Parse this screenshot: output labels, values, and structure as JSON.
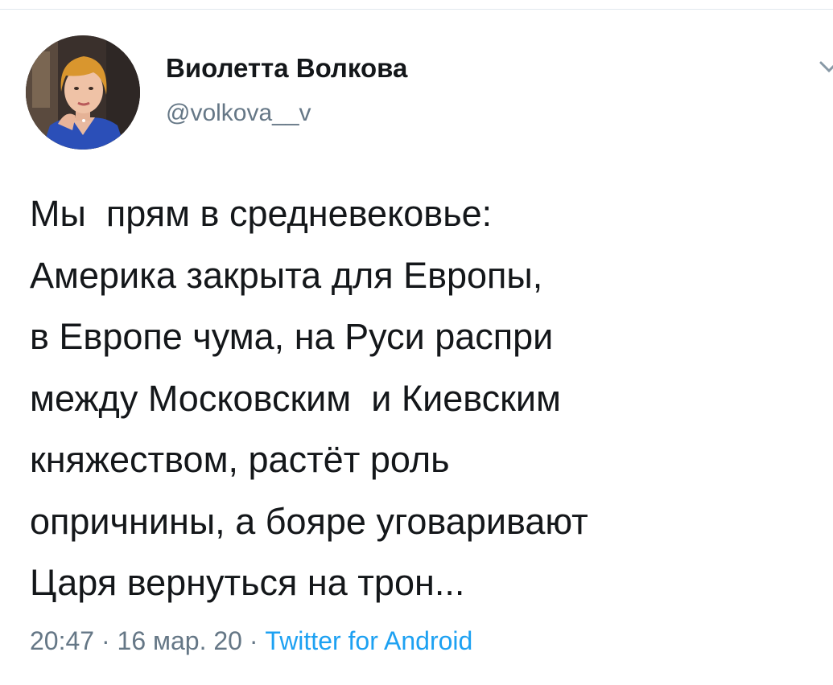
{
  "tweet": {
    "author": {
      "display_name": "Виолетта Волкова",
      "handle": "@volkova__v"
    },
    "text": "Мы  прям в средневековье:\nАмерика закрыта для Европы,\nв Европе чума, на Руси распри\nмежду Московским  и Киевским\nкняжеством, растёт роль\nопричнины, а бояре уговаривают\nЦаря вернуться на трон...",
    "time": "20:47",
    "date": "16 мар. 20",
    "separator": " · ",
    "source": "Twitter for Android"
  },
  "icons": {
    "menu": "chevron-down-icon",
    "avatar": "avatar-photo"
  },
  "colors": {
    "text": "#14171a",
    "secondary": "#657786",
    "link": "#1da1f2",
    "divider": "#e1e8ed"
  }
}
